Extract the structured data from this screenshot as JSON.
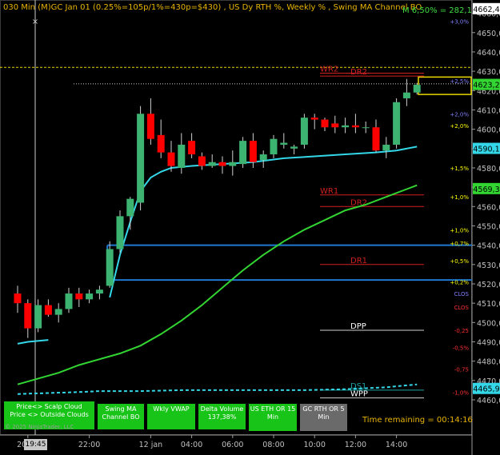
{
  "title": "030 Min  (M)GC Jan 01  (0.25%=105p/1%=430p=$430) , US Dy RTH %, Weekly % , Swing MA Channel BO",
  "title_right": "M 6,50% = 282,1",
  "time_remaining": "Time remaining = 00:14:16",
  "copyright": "© 2025 NinjaTrader, LLC",
  "cursor_time": "19:45",
  "buttons": [
    {
      "label": "Price<> Scalp Cloud\nPrice <> Outside Clouds",
      "color": "#18c418"
    },
    {
      "label": "Swing MA\nChannel BO",
      "color": "#18c418"
    },
    {
      "label": "Wkly VWAP",
      "color": "#18c418"
    },
    {
      "label": "Delta Volume\n137,38%",
      "color": "#18c418"
    },
    {
      "label": "US ETH OR 15\nMin",
      "color": "#18c418"
    },
    {
      "label": "GC RTH OR 5\nMin",
      "color": "#6a6a6a"
    }
  ],
  "colors": {
    "up_candle": "#3cb371",
    "down_candle": "#ff0000",
    "cyan_ma": "#34d7e8",
    "green_ma": "#32d532",
    "blue_box": "#1f78d1",
    "yellow_line": "#e8d800",
    "axis_text": "#c0c0c0"
  },
  "chart_data": {
    "type": "candlestick",
    "ylim": [
      4452,
      4668
    ],
    "y_ticks": [
      4460,
      4470,
      4480,
      4490,
      4500,
      4510,
      4520,
      4530,
      4540,
      4550,
      4560,
      4570,
      4580,
      4590,
      4600,
      4610,
      4620,
      4630,
      4640,
      4650,
      4660
    ],
    "y_tick_labels": [
      "4460,0",
      "4470,0",
      "4480,0",
      "4490,0",
      "4500,0",
      "4510,0",
      "4520,0",
      "4530,0",
      "4540,0",
      "4550,0",
      "4560,0",
      "4570,0",
      "4580,0",
      "4590,0",
      "4600,0",
      "4610,0",
      "4620,0",
      "4630,0",
      "4640,0",
      "4650,0",
      "4660,0"
    ],
    "x_labels": [
      {
        "index": 1,
        "label": "20:00"
      },
      {
        "index": 7,
        "label": "22:00"
      },
      {
        "index": 13,
        "label": "12 jan"
      },
      {
        "index": 17,
        "label": "04:00"
      },
      {
        "index": 21,
        "label": "06:00"
      },
      {
        "index": 25,
        "label": "08:00"
      },
      {
        "index": 29,
        "label": "10:00"
      },
      {
        "index": 33,
        "label": "12:00"
      },
      {
        "index": 37,
        "label": "14:00"
      }
    ],
    "candles": [
      {
        "o": 4515,
        "h": 4519,
        "l": 4505,
        "c": 4510
      },
      {
        "o": 4510,
        "h": 4512,
        "l": 4492,
        "c": 4497
      },
      {
        "o": 4497,
        "h": 4512,
        "l": 4495,
        "c": 4509
      },
      {
        "o": 4509,
        "h": 4512,
        "l": 4503,
        "c": 4504
      },
      {
        "o": 4504,
        "h": 4510,
        "l": 4500,
        "c": 4507
      },
      {
        "o": 4507,
        "h": 4518,
        "l": 4505,
        "c": 4515
      },
      {
        "o": 4515,
        "h": 4518,
        "l": 4508,
        "c": 4512
      },
      {
        "o": 4512,
        "h": 4517,
        "l": 4510,
        "c": 4515
      },
      {
        "o": 4515,
        "h": 4519,
        "l": 4512,
        "c": 4517
      },
      {
        "o": 4519,
        "h": 4542,
        "l": 4518,
        "c": 4538
      },
      {
        "o": 4538,
        "h": 4558,
        "l": 4536,
        "c": 4555
      },
      {
        "o": 4555,
        "h": 4565,
        "l": 4548,
        "c": 4564
      },
      {
        "o": 4562,
        "h": 4612,
        "l": 4558,
        "c": 4608
      },
      {
        "o": 4608,
        "h": 4616,
        "l": 4592,
        "c": 4595
      },
      {
        "o": 4597,
        "h": 4605,
        "l": 4585,
        "c": 4588
      },
      {
        "o": 4588,
        "h": 4594,
        "l": 4578,
        "c": 4581
      },
      {
        "o": 4580,
        "h": 4598,
        "l": 4577,
        "c": 4592
      },
      {
        "o": 4594,
        "h": 4598,
        "l": 4585,
        "c": 4587
      },
      {
        "o": 4586,
        "h": 4588,
        "l": 4579,
        "c": 4581
      },
      {
        "o": 4581,
        "h": 4587,
        "l": 4580,
        "c": 4583
      },
      {
        "o": 4583,
        "h": 4586,
        "l": 4577,
        "c": 4581
      },
      {
        "o": 4581,
        "h": 4589,
        "l": 4576,
        "c": 4583
      },
      {
        "o": 4582,
        "h": 4596,
        "l": 4580,
        "c": 4594
      },
      {
        "o": 4594,
        "h": 4598,
        "l": 4580,
        "c": 4583
      },
      {
        "o": 4584,
        "h": 4589,
        "l": 4580,
        "c": 4587
      },
      {
        "o": 4587,
        "h": 4597,
        "l": 4585,
        "c": 4595
      },
      {
        "o": 4592,
        "h": 4598,
        "l": 4590,
        "c": 4593
      },
      {
        "o": 4590,
        "h": 4592,
        "l": 4587,
        "c": 4591
      },
      {
        "o": 4592,
        "h": 4608,
        "l": 4590,
        "c": 4606
      },
      {
        "o": 4606,
        "h": 4608,
        "l": 4600,
        "c": 4605
      },
      {
        "o": 4605,
        "h": 4606,
        "l": 4599,
        "c": 4601
      },
      {
        "o": 4603,
        "h": 4607,
        "l": 4598,
        "c": 4601
      },
      {
        "o": 4601,
        "h": 4606,
        "l": 4598,
        "c": 4602
      },
      {
        "o": 4602,
        "h": 4608,
        "l": 4598,
        "c": 4601
      },
      {
        "o": 4601,
        "h": 4604,
        "l": 4598,
        "c": 4601
      },
      {
        "o": 4601,
        "h": 4605,
        "l": 4588,
        "c": 4589
      },
      {
        "o": 4589,
        "h": 4596,
        "l": 4585,
        "c": 4592
      },
      {
        "o": 4592,
        "h": 4616,
        "l": 4590,
        "c": 4614
      },
      {
        "o": 4616,
        "h": 4626,
        "l": 4612,
        "c": 4619
      },
      {
        "o": 4619,
        "h": 4624,
        "l": 4618,
        "c": 4623
      }
    ],
    "series": [
      {
        "name": "",
        "color": "#34d7e8",
        "points": [
          [
            0,
            4489
          ],
          [
            1,
            4490
          ],
          [
            3,
            4491
          ],
          [
            5,
            4492
          ],
          [
            7,
            4493
          ],
          [
            9,
            4513
          ],
          [
            10,
            4535
          ],
          [
            11,
            4552
          ],
          [
            12,
            4568
          ],
          [
            13,
            4575
          ],
          [
            14,
            4578
          ],
          [
            15,
            4580
          ],
          [
            17,
            4581
          ],
          [
            20,
            4582
          ],
          [
            23,
            4583
          ],
          [
            26,
            4585
          ],
          [
            29,
            4586
          ],
          [
            32,
            4587
          ],
          [
            35,
            4588
          ],
          [
            37,
            4589
          ],
          [
            39,
            4591
          ]
        ],
        "x_range": [
          0,
          39
        ],
        "partial_break": [
          3,
          9
        ]
      },
      {
        "name": "",
        "color": "#32d532",
        "points": [
          [
            0,
            4468
          ],
          [
            2,
            4471
          ],
          [
            4,
            4474
          ],
          [
            6,
            4478
          ],
          [
            8,
            4481
          ],
          [
            10,
            4484
          ],
          [
            12,
            4488
          ],
          [
            14,
            4494
          ],
          [
            16,
            4501
          ],
          [
            18,
            4509
          ],
          [
            20,
            4518
          ],
          [
            22,
            4527
          ],
          [
            24,
            4535
          ],
          [
            26,
            4542
          ],
          [
            28,
            4548
          ],
          [
            30,
            4553
          ],
          [
            32,
            4558
          ],
          [
            34,
            4561
          ],
          [
            36,
            4565
          ],
          [
            38,
            4569
          ],
          [
            39,
            4571
          ]
        ]
      },
      {
        "name": "",
        "color": "#34d7e8",
        "dashed": true,
        "points": [
          [
            0,
            4463
          ],
          [
            3,
            4463.5
          ],
          [
            6,
            4464
          ],
          [
            8,
            4464.5
          ],
          [
            12,
            4464.5
          ],
          [
            16,
            4465
          ],
          [
            20,
            4465
          ],
          [
            24,
            4465
          ],
          [
            28,
            4465
          ],
          [
            32,
            4465.5
          ],
          [
            36,
            4466.5
          ],
          [
            39,
            4468
          ]
        ]
      }
    ],
    "h_levels": [
      {
        "label": "WR2",
        "value": 4629,
        "color": "#d02020",
        "text_color": "#d02020"
      },
      {
        "label": "DR2",
        "value": 4627.5,
        "color": "#d02020",
        "text_color": "#d02020"
      },
      {
        "label": "WR1",
        "value": 4566,
        "color": "#d02020",
        "text_color": "#d02020"
      },
      {
        "label": "DR2",
        "value": 4560,
        "color": "#d02020",
        "text_color": "#d02020"
      },
      {
        "label": "DR1",
        "value": 4530,
        "color": "#d02020",
        "text_color": "#d02020"
      },
      {
        "label": "DPP",
        "value": 4496,
        "color": "#d0d0d0",
        "text_color": "#ffffff"
      },
      {
        "label": "DS1",
        "value": 4465,
        "color": "#20a0a0",
        "text_color": "#20a0a0"
      },
      {
        "label": "WPP",
        "value": 4461,
        "color": "#d0d0d0",
        "text_color": "#ffffff"
      }
    ],
    "right_pct_labels": [
      {
        "text": "+3,0%",
        "value": 4656,
        "color": "#8080ff"
      },
      {
        "text": "+2,5%",
        "value": 4625,
        "color": "#8080ff"
      },
      {
        "text": "+2,0%",
        "value": 4608,
        "color": "#8080ff"
      },
      {
        "text": "+2,0%",
        "value": 4602,
        "color": "#ffff00"
      },
      {
        "text": "+1,5%",
        "value": 4580,
        "color": "#ffff00"
      },
      {
        "text": "+1,0%",
        "value": 4565,
        "color": "#ffff00"
      },
      {
        "text": "+1,0%",
        "value": 4548,
        "color": "#ffff00"
      },
      {
        "text": "+0,7%",
        "value": 4541,
        "color": "#ffff00"
      },
      {
        "text": "+0,5%",
        "value": 4532,
        "color": "#ffff00"
      },
      {
        "text": "+0,2%",
        "value": 4521,
        "color": "#ffff00"
      },
      {
        "text": "CLOS",
        "value": 4515,
        "color": "#8080ff"
      },
      {
        "text": "CLOS",
        "value": 4508,
        "color": "#ff3030"
      },
      {
        "text": "-0,25",
        "value": 4496,
        "color": "#ff3030"
      },
      {
        "text": "-0,5%",
        "value": 4487,
        "color": "#ff3030"
      },
      {
        "text": "-0,75",
        "value": 4476,
        "color": "#ff3030"
      },
      {
        "text": "-1,0%",
        "value": 4464,
        "color": "#ff3030"
      }
    ],
    "price_badges": [
      {
        "text": "4662,4",
        "value": 4662.4,
        "bg": "#ffffff",
        "fg": "#000000"
      },
      {
        "text": "4623,2",
        "value": 4623.2,
        "bg": "#32d532",
        "fg": "#000000"
      },
      {
        "text": "4590,1",
        "value": 4590.1,
        "bg": "#34d7e8",
        "fg": "#000000"
      },
      {
        "text": "4569,3",
        "value": 4569.3,
        "bg": "#32d532",
        "fg": "#000000"
      },
      {
        "text": "4465,9",
        "value": 4465.9,
        "bg": "#34d7e8",
        "fg": "#000000"
      }
    ],
    "box_lines": [
      {
        "value": 4540
      },
      {
        "value": 4522
      }
    ],
    "yellow_dashed": 4632,
    "white_dotted": 4623.5
  }
}
